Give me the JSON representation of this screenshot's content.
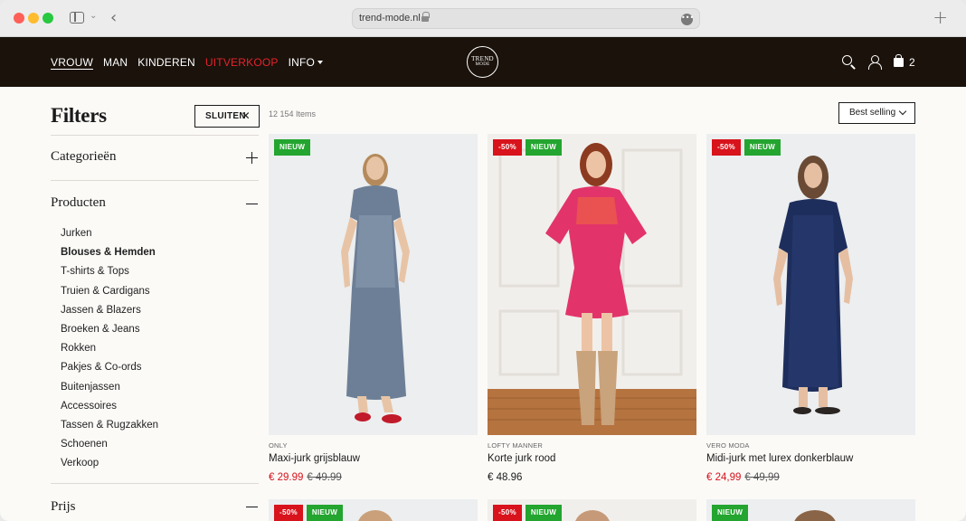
{
  "browser": {
    "url": "trend-mode.nl",
    "more_glyph": "•••",
    "back_glyph": "‹",
    "newtab_glyph": "+",
    "toggle_chevron": "⌄"
  },
  "header": {
    "nav": [
      {
        "label": "VROUW",
        "state": "active"
      },
      {
        "label": "MAN",
        "state": "normal"
      },
      {
        "label": "KINDEREN",
        "state": "normal"
      },
      {
        "label": "UITVERKOOP",
        "state": "sale"
      },
      {
        "label": "INFO",
        "state": "dropdown"
      }
    ],
    "logo_line1": "TREND",
    "logo_line2": "MODE",
    "cart_count": "2",
    "icons": [
      "search-icon",
      "user-icon",
      "bag-icon"
    ],
    "colors": {
      "background": "#1a120b",
      "sale": "#e5232b"
    }
  },
  "filters": {
    "title": "Filters",
    "close_label": "SLUITEN",
    "close_glyph": "✕",
    "sections": [
      {
        "title": "Categorieën",
        "expanded": false
      },
      {
        "title": "Producten",
        "expanded": true
      },
      {
        "title": "Prijs",
        "expanded": true
      }
    ],
    "products": [
      {
        "label": "Jurken",
        "selected": false
      },
      {
        "label": "Blouses & Hemden",
        "selected": true
      },
      {
        "label": "T-shirts & Tops",
        "selected": false
      },
      {
        "label": "Truien & Cardigans",
        "selected": false
      },
      {
        "label": "Jassen & Blazers",
        "selected": false
      },
      {
        "label": "Broeken & Jeans",
        "selected": false
      },
      {
        "label": "Rokken",
        "selected": false
      },
      {
        "label": "Pakjes & Co-ords",
        "selected": false
      },
      {
        "label": "Buitenjassen",
        "selected": false
      },
      {
        "label": "Accessoires",
        "selected": false
      },
      {
        "label": "Tassen & Rugzakken",
        "selected": false
      },
      {
        "label": "Schoenen",
        "selected": false
      },
      {
        "label": "Verkoop",
        "selected": false
      }
    ]
  },
  "grid": {
    "items_count": "12 154 Items",
    "sort_label": "Best selling",
    "products": [
      {
        "brand": "ONLY",
        "name": "Maxi-jurk grijsblauw",
        "price": "€ 29.99",
        "old_price": "€ 49.99",
        "badges": [
          "NIEUW"
        ]
      },
      {
        "brand": "LOFTY MANNER",
        "name": "Korte jurk rood",
        "price": "€ 48.96",
        "old_price": "",
        "badges": [
          "-50%",
          "NIEUW"
        ]
      },
      {
        "brand": "VERO MODA",
        "name": "Midi-jurk met lurex donkerblauw",
        "price": "€ 24,99",
        "old_price": "€ 49,99",
        "badges": [
          "-50%",
          "NIEUW"
        ]
      }
    ],
    "next_row_badges": [
      [
        "-50%",
        "NIEUW"
      ],
      [
        "-50%",
        "NIEUW"
      ],
      [
        "NIEUW"
      ]
    ],
    "colors": {
      "sale_badge": "#d8131c",
      "new_badge": "#23a52f",
      "sale_price": "#d8131c"
    }
  }
}
